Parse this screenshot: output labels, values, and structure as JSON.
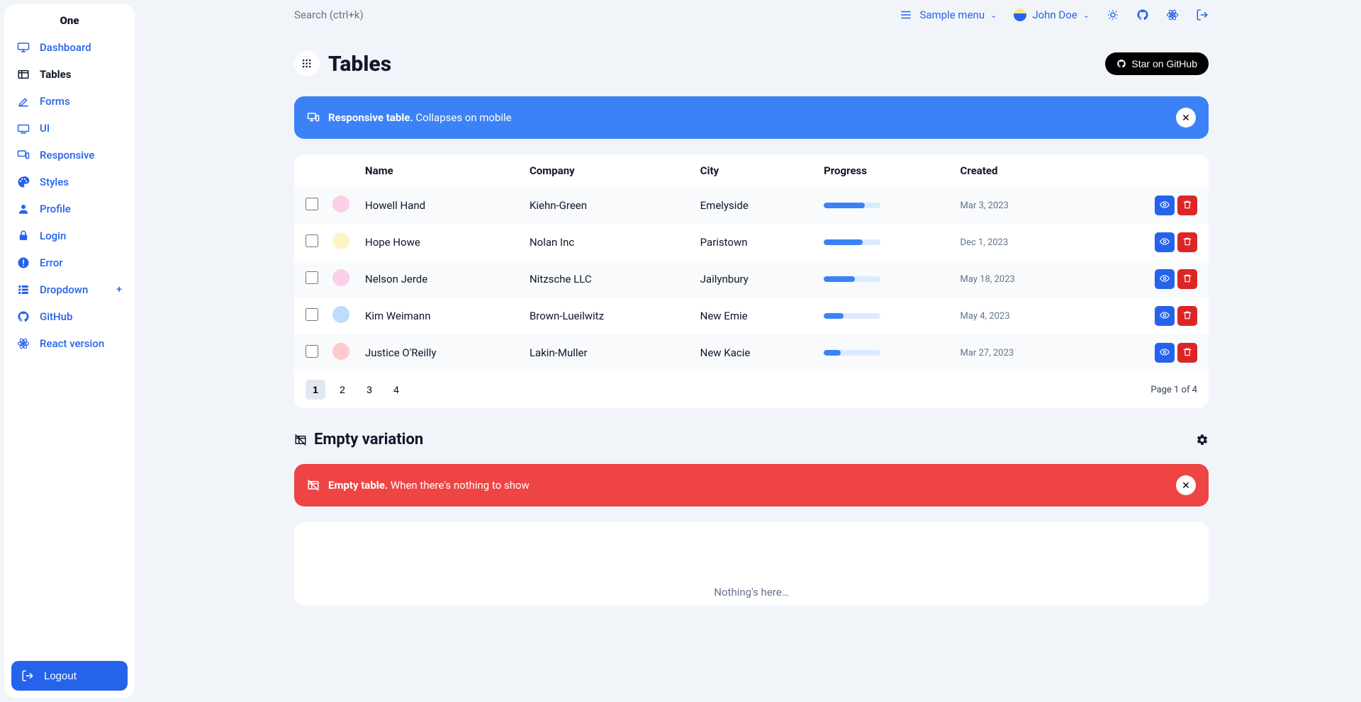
{
  "brand": "One",
  "search_placeholder": "Search (ctrl+k)",
  "top_menu": {
    "label": "Sample menu"
  },
  "user_name": "John Doe",
  "sidebar": [
    {
      "label": "Dashboard",
      "icon": "monitor-icon",
      "active": false
    },
    {
      "label": "Tables",
      "icon": "table-icon",
      "active": true
    },
    {
      "label": "Forms",
      "icon": "edit-icon",
      "active": false
    },
    {
      "label": "UI",
      "icon": "tv-icon",
      "active": false
    },
    {
      "label": "Responsive",
      "icon": "devices-icon",
      "active": false
    },
    {
      "label": "Styles",
      "icon": "palette-icon",
      "active": false
    },
    {
      "label": "Profile",
      "icon": "account-icon",
      "active": false
    },
    {
      "label": "Login",
      "icon": "lock-icon",
      "active": false
    },
    {
      "label": "Error",
      "icon": "alert-icon",
      "active": false
    },
    {
      "label": "Dropdown",
      "icon": "view-list-icon",
      "active": false,
      "expandable": true
    },
    {
      "label": "GitHub",
      "icon": "github-icon",
      "active": false
    },
    {
      "label": "React version",
      "icon": "react-icon",
      "active": false
    }
  ],
  "logout_label": "Logout",
  "page_title": "Tables",
  "star_label": "Star on GitHub",
  "notif_blue": {
    "strong": "Responsive table.",
    "rest": " Collapses on mobile"
  },
  "table": {
    "headers": [
      "Name",
      "Company",
      "City",
      "Progress",
      "Created"
    ],
    "rows": [
      {
        "name": "Howell Hand",
        "company": "Kiehn-Green",
        "city": "Emelyside",
        "progress": 72,
        "created": "Mar 3, 2023",
        "avatar": "#fbcfe8"
      },
      {
        "name": "Hope Howe",
        "company": "Nolan Inc",
        "city": "Paristown",
        "progress": 68,
        "created": "Dec 1, 2023",
        "avatar": "#fef3c7"
      },
      {
        "name": "Nelson Jerde",
        "company": "Nitzsche LLC",
        "city": "Jailynbury",
        "progress": 55,
        "created": "May 18, 2023",
        "avatar": "#fbcfe8"
      },
      {
        "name": "Kim Weimann",
        "company": "Brown-Lueilwitz",
        "city": "New Emie",
        "progress": 35,
        "created": "May 4, 2023",
        "avatar": "#bfdbfe"
      },
      {
        "name": "Justice O'Reilly",
        "company": "Lakin-Muller",
        "city": "New Kacie",
        "progress": 30,
        "created": "Mar 27, 2023",
        "avatar": "#fecaca"
      }
    ],
    "pages": [
      "1",
      "2",
      "3",
      "4"
    ],
    "page_info": "Page 1 of 4"
  },
  "empty_section_title": "Empty variation",
  "notif_red": {
    "strong": "Empty table.",
    "rest": " When there's nothing to show"
  },
  "empty_text": "Nothing's here…"
}
